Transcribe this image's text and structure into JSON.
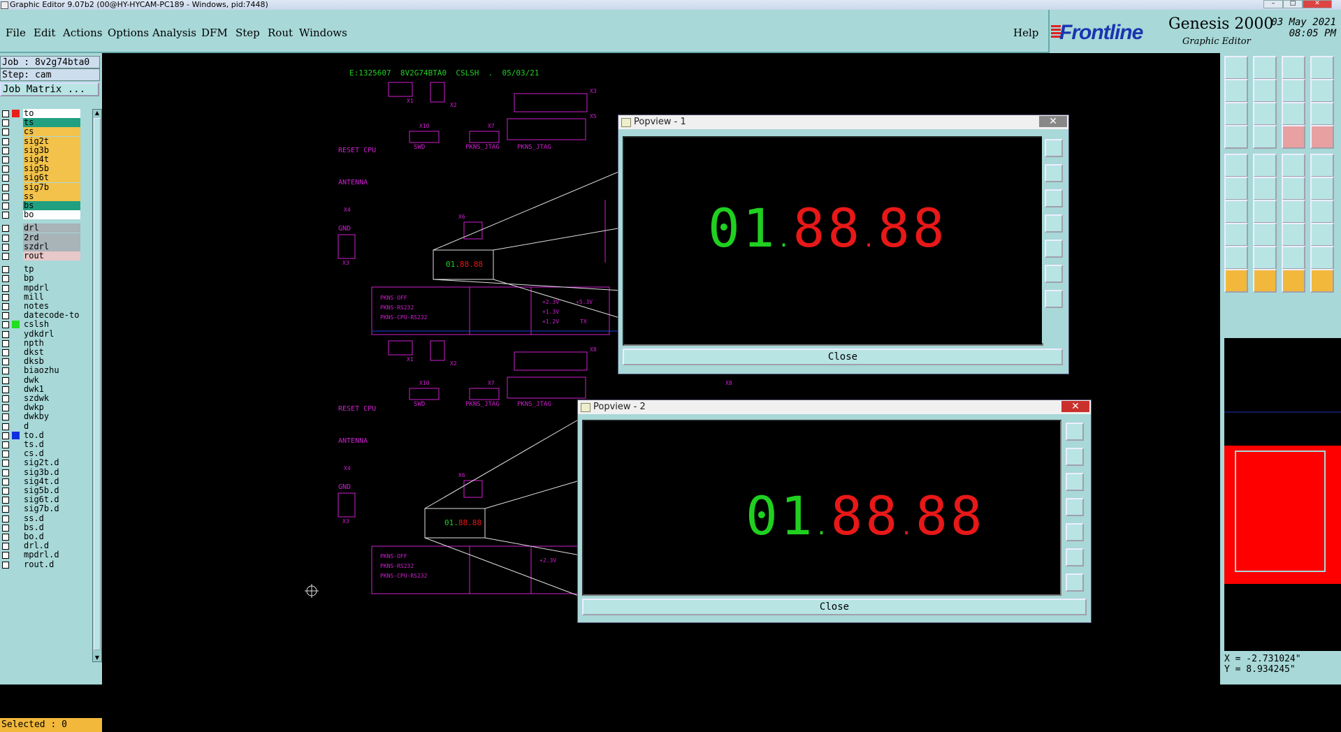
{
  "window": {
    "title": "Graphic Editor 9.07b2 (00@HY-HYCAM-PC189 - Windows, pid:7448)"
  },
  "menu": {
    "items": [
      "File",
      "Edit",
      "Actions",
      "Options",
      "Analysis",
      "DFM",
      "Step",
      "Rout",
      "Windows"
    ],
    "help": "Help"
  },
  "brand": {
    "logo": "Frontline",
    "product": "Genesis 2000",
    "subtitle": "Graphic Editor",
    "date": "03 May 2021",
    "time": "08:05 PM"
  },
  "job": {
    "job_line": "Job : 8v2g74bta0",
    "step_line": "Step: cam",
    "matrix_button": "Job Matrix ..."
  },
  "layers": [
    {
      "name": "to",
      "bg": "#ffffff",
      "swatch": "#e8201a",
      "checked": true
    },
    {
      "name": "ts",
      "bg": "#20a080"
    },
    {
      "name": "cs",
      "bg": "#f2c24a"
    },
    {
      "name": "sig2t",
      "bg": "#f2c24a"
    },
    {
      "name": "sig3b",
      "bg": "#f2c24a"
    },
    {
      "name": "sig4t",
      "bg": "#f2c24a"
    },
    {
      "name": "sig5b",
      "bg": "#f2c24a"
    },
    {
      "name": "sig6t",
      "bg": "#f2c24a"
    },
    {
      "name": "sig7b",
      "bg": "#f2c24a"
    },
    {
      "name": "ss",
      "bg": "#f2c24a"
    },
    {
      "name": "bs",
      "bg": "#20a080"
    },
    {
      "name": "bo",
      "bg": "#ffffff"
    },
    {
      "name": "drl",
      "bg": "#a8b4b8"
    },
    {
      "name": "2rd",
      "bg": "#a8b4b8"
    },
    {
      "name": "szdrl",
      "bg": "#a8b4b8"
    },
    {
      "name": "rout",
      "bg": "#e8c8c8"
    },
    {
      "name": "tp",
      "bg": "#a8d8d8"
    },
    {
      "name": "bp",
      "bg": "#a8d8d8"
    },
    {
      "name": "mpdrl",
      "bg": "#a8d8d8"
    },
    {
      "name": "mill",
      "bg": "#a8d8d8"
    },
    {
      "name": "notes",
      "bg": "#a8d8d8"
    },
    {
      "name": "datecode-to",
      "bg": "#a8d8d8"
    },
    {
      "name": "cslsh",
      "bg": "#a8d8d8",
      "swatch": "#20e020"
    },
    {
      "name": "ydkdrl",
      "bg": "#a8d8d8"
    },
    {
      "name": "npth",
      "bg": "#a8d8d8"
    },
    {
      "name": "dkst",
      "bg": "#a8d8d8"
    },
    {
      "name": "dksb",
      "bg": "#a8d8d8"
    },
    {
      "name": "biaozhu",
      "bg": "#a8d8d8"
    },
    {
      "name": "dwk",
      "bg": "#a8d8d8"
    },
    {
      "name": "dwk1",
      "bg": "#a8d8d8"
    },
    {
      "name": "szdwk",
      "bg": "#a8d8d8"
    },
    {
      "name": "dwkp",
      "bg": "#a8d8d8"
    },
    {
      "name": "dwkby",
      "bg": "#a8d8d8"
    },
    {
      "name": "d",
      "bg": "#a8d8d8"
    },
    {
      "name": "to.d",
      "bg": "#a8d8d8",
      "swatch": "#1030e0"
    },
    {
      "name": "ts.d",
      "bg": "#a8d8d8"
    },
    {
      "name": "cs.d",
      "bg": "#a8d8d8"
    },
    {
      "name": "sig2t.d",
      "bg": "#a8d8d8"
    },
    {
      "name": "sig3b.d",
      "bg": "#a8d8d8"
    },
    {
      "name": "sig4t.d",
      "bg": "#a8d8d8"
    },
    {
      "name": "sig5b.d",
      "bg": "#a8d8d8"
    },
    {
      "name": "sig6t.d",
      "bg": "#a8d8d8"
    },
    {
      "name": "sig7b.d",
      "bg": "#a8d8d8"
    },
    {
      "name": "ss.d",
      "bg": "#a8d8d8"
    },
    {
      "name": "bs.d",
      "bg": "#a8d8d8"
    },
    {
      "name": "bo.d",
      "bg": "#a8d8d8"
    },
    {
      "name": "drl.d",
      "bg": "#a8d8d8"
    },
    {
      "name": "mpdrl.d",
      "bg": "#a8d8d8"
    },
    {
      "name": "rout.d",
      "bg": "#a8d8d8"
    }
  ],
  "status": {
    "selected": "Selected : 0"
  },
  "canvas": {
    "header_text": "E:1325607  8V2G74BTA0  CSLSH  .  05/03/21",
    "labels": {
      "reset_cpu": "RESET CPU",
      "antenna": "ANTENNA",
      "gnd": "GND",
      "swd": "SWD",
      "pkns_jtag": "PKNS_JTAG",
      "pkns_off": "PKNS-OFF",
      "pkns_rs232": "PKNS-RS232",
      "pkns_cpu": "PKNS-CPU-RS232",
      "x1": "X1",
      "x2": "X2",
      "x3": "X3",
      "x4": "X4",
      "x5": "X5",
      "x6": "X6",
      "x7": "X7",
      "x8": "X8",
      "x10": "X10",
      "v23": "+2.3V",
      "v53": "+5.3V",
      "v13": "+1.3V",
      "v12": "+1.2V",
      "tx": "TX"
    },
    "mini_code": {
      "green": "01.",
      "red": "88.88"
    }
  },
  "popview1": {
    "title": "Popview - 1",
    "close_glyph": "✕",
    "close_button": "Close",
    "display_green": "01",
    "display_dot1": ".",
    "display_red1": "88",
    "display_dot2": ".",
    "display_red2": "88"
  },
  "popview2": {
    "title": "Popview - 2",
    "close_glyph": "✕",
    "close_button": "Close",
    "display_green": "01",
    "display_dot1": ".",
    "display_red1": "88",
    "display_dot2": ".",
    "display_red2": "88"
  },
  "coords": {
    "x": "X = -2.731024\"",
    "y": "Y = 8.934245\""
  },
  "colors": {
    "panel": "#a8d8d8",
    "pcb_magenta": "#d020d0",
    "led_green": "#20d020",
    "led_red": "#e81818",
    "minimap_red": "#ff0000"
  }
}
